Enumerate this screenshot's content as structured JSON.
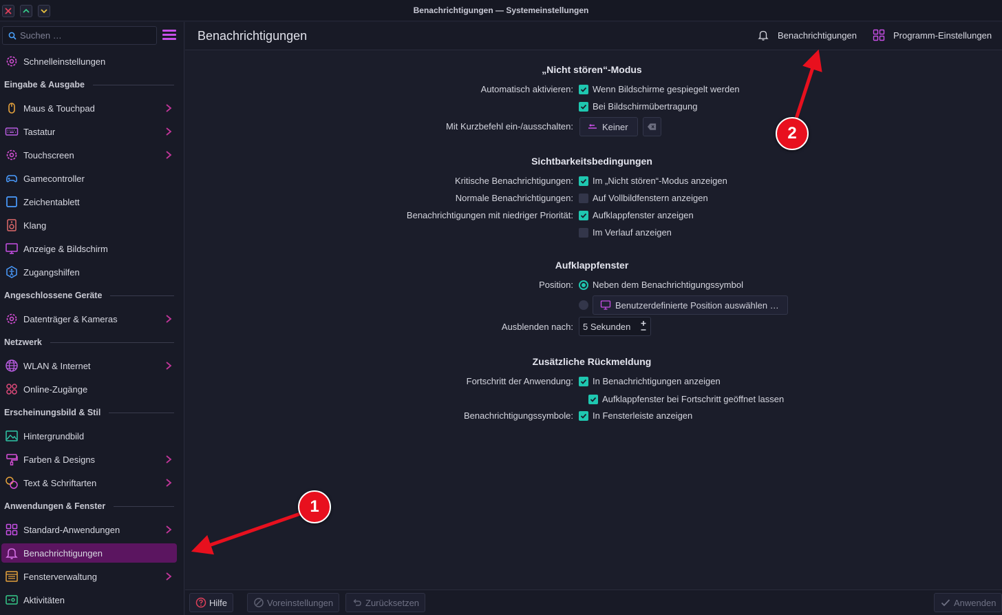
{
  "window": {
    "title": "Benachrichtigungen — Systemeinstellungen"
  },
  "sidebar": {
    "search_placeholder": "Suchen …",
    "top_item": {
      "label": "Schnelleinstellungen",
      "icon": "gear-icon"
    },
    "sections": [
      {
        "title": "Eingabe & Ausgabe",
        "items": [
          {
            "label": "Maus & Touchpad",
            "icon": "mouse-icon",
            "chevron": true
          },
          {
            "label": "Tastatur",
            "icon": "keyboard-icon",
            "chevron": true
          },
          {
            "label": "Touchscreen",
            "icon": "gear-icon",
            "chevron": true
          },
          {
            "label": "Gamecontroller",
            "icon": "gamepad-icon",
            "chevron": false
          },
          {
            "label": "Zeichentablett",
            "icon": "tablet-icon",
            "chevron": false
          },
          {
            "label": "Klang",
            "icon": "speaker-icon",
            "chevron": false
          },
          {
            "label": "Anzeige & Bildschirm",
            "icon": "monitor-icon",
            "chevron": false
          },
          {
            "label": "Zugangshilfen",
            "icon": "accessibility-icon",
            "chevron": false
          }
        ]
      },
      {
        "title": "Angeschlossene Geräte",
        "items": [
          {
            "label": "Datenträger & Kameras",
            "icon": "gear-icon",
            "chevron": true
          }
        ]
      },
      {
        "title": "Netzwerk",
        "items": [
          {
            "label": "WLAN & Internet",
            "icon": "globe-icon",
            "chevron": true
          },
          {
            "label": "Online-Zugänge",
            "icon": "accounts-icon",
            "chevron": false
          }
        ]
      },
      {
        "title": "Erscheinungsbild & Stil",
        "items": [
          {
            "label": "Hintergrundbild",
            "icon": "image-icon",
            "chevron": false
          },
          {
            "label": "Farben & Designs",
            "icon": "paint-icon",
            "chevron": true
          },
          {
            "label": "Text & Schriftarten",
            "icon": "font-icon",
            "chevron": true
          }
        ]
      },
      {
        "title": "Anwendungen & Fenster",
        "items": [
          {
            "label": "Standard-Anwendungen",
            "icon": "grid-icon",
            "chevron": true
          },
          {
            "label": "Benachrichtigungen",
            "icon": "bell-icon",
            "chevron": false,
            "active": true
          },
          {
            "label": "Fensterverwaltung",
            "icon": "window-icon",
            "chevron": true
          },
          {
            "label": "Aktivitäten",
            "icon": "activities-icon",
            "chevron": false
          }
        ]
      }
    ]
  },
  "header": {
    "page_title": "Benachrichtigungen",
    "notifications_button": "Benachrichtigungen",
    "app_settings_button": "Programm-Einstellungen"
  },
  "dnd": {
    "title": "„Nicht stören“-Modus",
    "auto_label": "Automatisch aktivieren:",
    "opt_mirrored": "Wenn Bildschirme gespiegelt werden",
    "opt_screencast": "Bei Bildschirmübertragung",
    "shortcut_label": "Mit Kurzbefehl ein-/ausschalten:",
    "shortcut_value": "Keiner"
  },
  "visibility": {
    "title": "Sichtbarkeitsbedingungen",
    "critical_label": "Kritische Benachrichtigungen:",
    "critical_opt": "Im „Nicht stören“-Modus anzeigen",
    "normal_label": "Normale Benachrichtigungen:",
    "normal_opt": "Auf Vollbildfenstern anzeigen",
    "low_label": "Benachrichtigungen mit niedriger Priorität:",
    "low_opt_popup": "Aufklappfenster anzeigen",
    "low_opt_history": "Im Verlauf anzeigen"
  },
  "popup": {
    "title": "Aufklappfenster",
    "position_label": "Position:",
    "position_opt_icon": "Neben dem Benachrichtigungssymbol",
    "position_custom_button": "Benutzerdefinierte Position auswählen …",
    "hide_label": "Ausblenden nach:",
    "hide_value": "5 Sekunden"
  },
  "feedback": {
    "title": "Zusätzliche Rückmeldung",
    "progress_label": "Fortschritt der Anwendung:",
    "progress_opt": "In Benachrichtigungen anzeigen",
    "progress_sub_opt": "Aufklappfenster bei Fortschritt geöffnet lassen",
    "badges_label": "Benachrichtigungssymbole:",
    "badges_opt": "In Fensterleiste anzeigen"
  },
  "footer": {
    "help": "Hilfe",
    "defaults": "Voreinstellungen",
    "reset": "Zurücksetzen",
    "apply": "Anwenden"
  },
  "annotations": {
    "badge_1": "1",
    "badge_2": "2"
  },
  "colors": {
    "accent_check": "#1fc7b0",
    "active_item": "#5b1560",
    "annotation_red": "#e8101e"
  }
}
